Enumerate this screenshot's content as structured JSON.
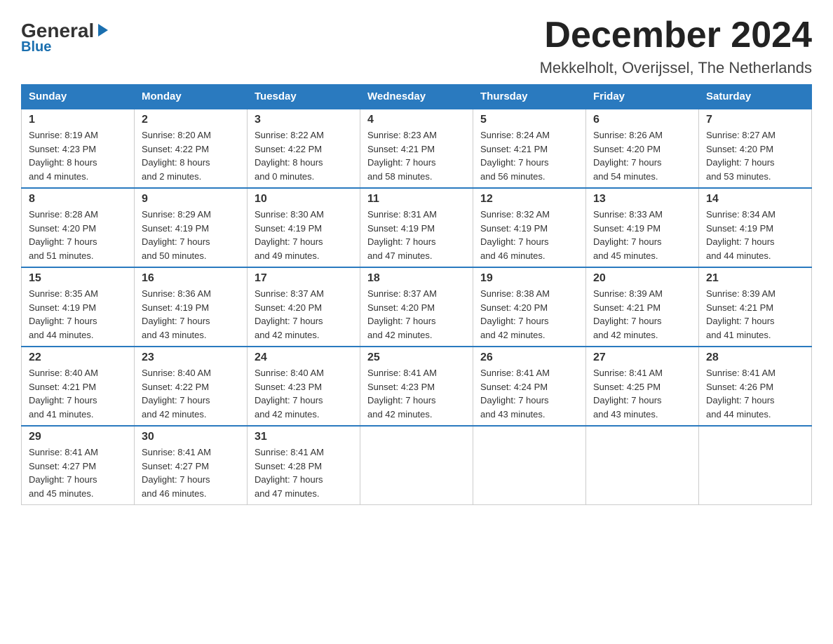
{
  "logo": {
    "general": "General",
    "blue": "Blue",
    "arrow": "▶"
  },
  "title": "December 2024",
  "subtitle": "Mekkelholt, Overijssel, The Netherlands",
  "headers": [
    "Sunday",
    "Monday",
    "Tuesday",
    "Wednesday",
    "Thursday",
    "Friday",
    "Saturday"
  ],
  "weeks": [
    [
      {
        "day": "1",
        "info": "Sunrise: 8:19 AM\nSunset: 4:23 PM\nDaylight: 8 hours\nand 4 minutes."
      },
      {
        "day": "2",
        "info": "Sunrise: 8:20 AM\nSunset: 4:22 PM\nDaylight: 8 hours\nand 2 minutes."
      },
      {
        "day": "3",
        "info": "Sunrise: 8:22 AM\nSunset: 4:22 PM\nDaylight: 8 hours\nand 0 minutes."
      },
      {
        "day": "4",
        "info": "Sunrise: 8:23 AM\nSunset: 4:21 PM\nDaylight: 7 hours\nand 58 minutes."
      },
      {
        "day": "5",
        "info": "Sunrise: 8:24 AM\nSunset: 4:21 PM\nDaylight: 7 hours\nand 56 minutes."
      },
      {
        "day": "6",
        "info": "Sunrise: 8:26 AM\nSunset: 4:20 PM\nDaylight: 7 hours\nand 54 minutes."
      },
      {
        "day": "7",
        "info": "Sunrise: 8:27 AM\nSunset: 4:20 PM\nDaylight: 7 hours\nand 53 minutes."
      }
    ],
    [
      {
        "day": "8",
        "info": "Sunrise: 8:28 AM\nSunset: 4:20 PM\nDaylight: 7 hours\nand 51 minutes."
      },
      {
        "day": "9",
        "info": "Sunrise: 8:29 AM\nSunset: 4:19 PM\nDaylight: 7 hours\nand 50 minutes."
      },
      {
        "day": "10",
        "info": "Sunrise: 8:30 AM\nSunset: 4:19 PM\nDaylight: 7 hours\nand 49 minutes."
      },
      {
        "day": "11",
        "info": "Sunrise: 8:31 AM\nSunset: 4:19 PM\nDaylight: 7 hours\nand 47 minutes."
      },
      {
        "day": "12",
        "info": "Sunrise: 8:32 AM\nSunset: 4:19 PM\nDaylight: 7 hours\nand 46 minutes."
      },
      {
        "day": "13",
        "info": "Sunrise: 8:33 AM\nSunset: 4:19 PM\nDaylight: 7 hours\nand 45 minutes."
      },
      {
        "day": "14",
        "info": "Sunrise: 8:34 AM\nSunset: 4:19 PM\nDaylight: 7 hours\nand 44 minutes."
      }
    ],
    [
      {
        "day": "15",
        "info": "Sunrise: 8:35 AM\nSunset: 4:19 PM\nDaylight: 7 hours\nand 44 minutes."
      },
      {
        "day": "16",
        "info": "Sunrise: 8:36 AM\nSunset: 4:19 PM\nDaylight: 7 hours\nand 43 minutes."
      },
      {
        "day": "17",
        "info": "Sunrise: 8:37 AM\nSunset: 4:20 PM\nDaylight: 7 hours\nand 42 minutes."
      },
      {
        "day": "18",
        "info": "Sunrise: 8:37 AM\nSunset: 4:20 PM\nDaylight: 7 hours\nand 42 minutes."
      },
      {
        "day": "19",
        "info": "Sunrise: 8:38 AM\nSunset: 4:20 PM\nDaylight: 7 hours\nand 42 minutes."
      },
      {
        "day": "20",
        "info": "Sunrise: 8:39 AM\nSunset: 4:21 PM\nDaylight: 7 hours\nand 42 minutes."
      },
      {
        "day": "21",
        "info": "Sunrise: 8:39 AM\nSunset: 4:21 PM\nDaylight: 7 hours\nand 41 minutes."
      }
    ],
    [
      {
        "day": "22",
        "info": "Sunrise: 8:40 AM\nSunset: 4:21 PM\nDaylight: 7 hours\nand 41 minutes."
      },
      {
        "day": "23",
        "info": "Sunrise: 8:40 AM\nSunset: 4:22 PM\nDaylight: 7 hours\nand 42 minutes."
      },
      {
        "day": "24",
        "info": "Sunrise: 8:40 AM\nSunset: 4:23 PM\nDaylight: 7 hours\nand 42 minutes."
      },
      {
        "day": "25",
        "info": "Sunrise: 8:41 AM\nSunset: 4:23 PM\nDaylight: 7 hours\nand 42 minutes."
      },
      {
        "day": "26",
        "info": "Sunrise: 8:41 AM\nSunset: 4:24 PM\nDaylight: 7 hours\nand 43 minutes."
      },
      {
        "day": "27",
        "info": "Sunrise: 8:41 AM\nSunset: 4:25 PM\nDaylight: 7 hours\nand 43 minutes."
      },
      {
        "day": "28",
        "info": "Sunrise: 8:41 AM\nSunset: 4:26 PM\nDaylight: 7 hours\nand 44 minutes."
      }
    ],
    [
      {
        "day": "29",
        "info": "Sunrise: 8:41 AM\nSunset: 4:27 PM\nDaylight: 7 hours\nand 45 minutes."
      },
      {
        "day": "30",
        "info": "Sunrise: 8:41 AM\nSunset: 4:27 PM\nDaylight: 7 hours\nand 46 minutes."
      },
      {
        "day": "31",
        "info": "Sunrise: 8:41 AM\nSunset: 4:28 PM\nDaylight: 7 hours\nand 47 minutes."
      },
      {
        "day": "",
        "info": ""
      },
      {
        "day": "",
        "info": ""
      },
      {
        "day": "",
        "info": ""
      },
      {
        "day": "",
        "info": ""
      }
    ]
  ]
}
